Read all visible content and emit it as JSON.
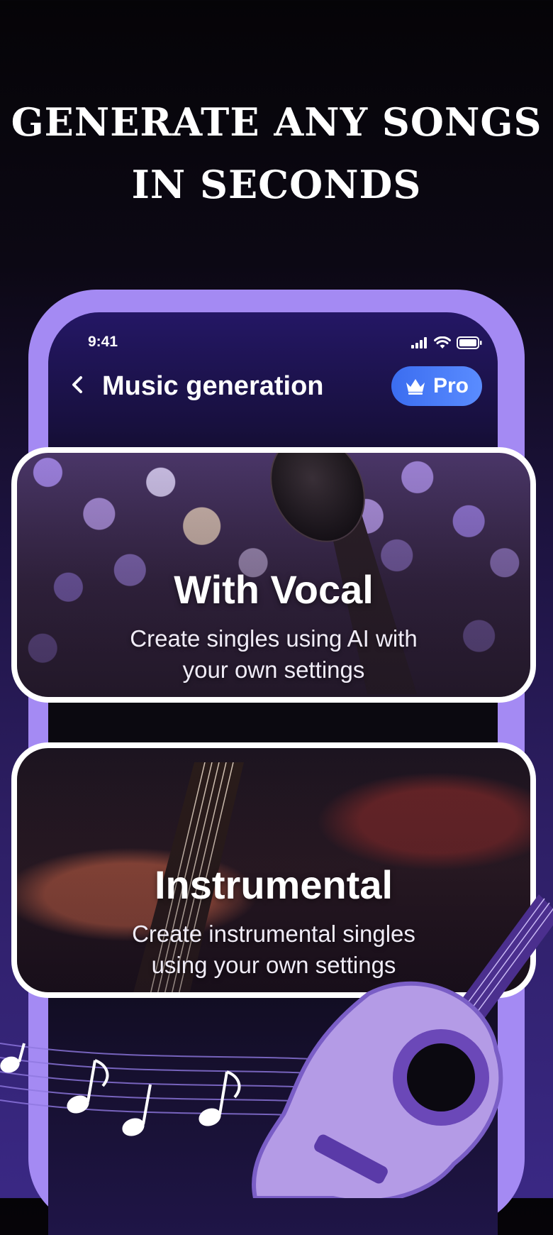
{
  "headline": {
    "line1": "GENERATE ANY SONGS",
    "line2": "IN SECONDS"
  },
  "status_bar": {
    "time": "9:41"
  },
  "nav": {
    "title": "Music generation",
    "back_icon": "chevron-left-icon",
    "pro_label": "Pro",
    "pro_icon": "crown-icon"
  },
  "cards": [
    {
      "title": "With Vocal",
      "description_line1": "Create singles using AI with",
      "description_line2": "your own settings"
    },
    {
      "title": "Instrumental",
      "description_line1": "Create instrumental singles",
      "description_line2": "using your own settings"
    }
  ],
  "colors": {
    "frame": "#a48af3",
    "pro_button": "#4a7cf6",
    "background_bottom": "#3a2884"
  }
}
